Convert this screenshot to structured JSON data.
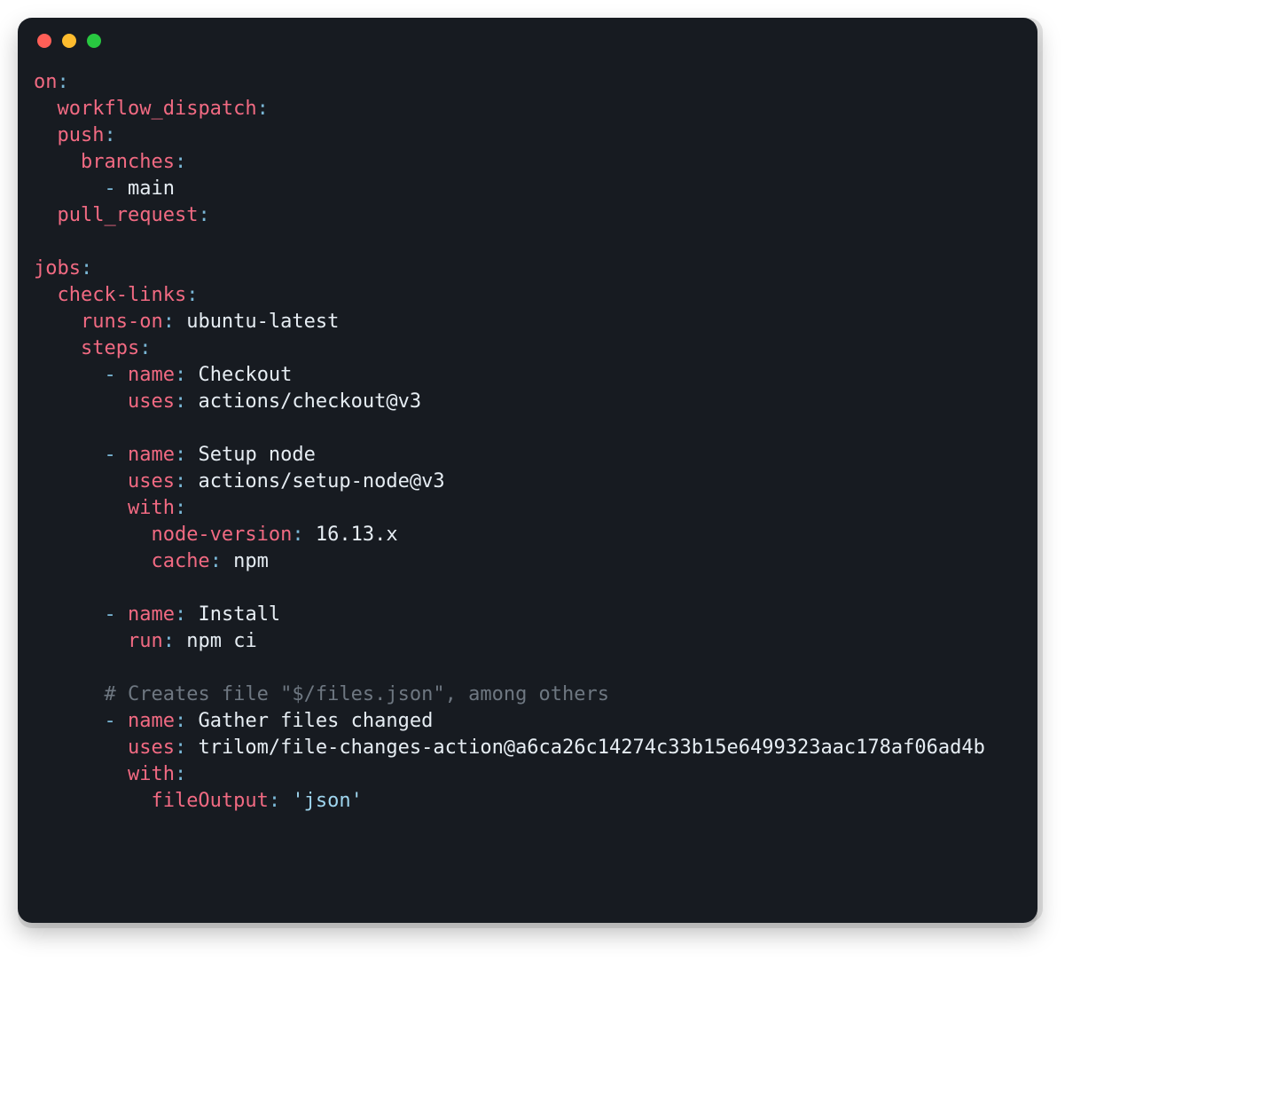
{
  "lines": [
    [
      {
        "t": "on",
        "c": "key"
      },
      {
        "t": ":",
        "c": "punct"
      }
    ],
    [
      {
        "t": "  ",
        "c": "plain"
      },
      {
        "t": "workflow_dispatch",
        "c": "key"
      },
      {
        "t": ":",
        "c": "punct"
      }
    ],
    [
      {
        "t": "  ",
        "c": "plain"
      },
      {
        "t": "push",
        "c": "key"
      },
      {
        "t": ":",
        "c": "punct"
      }
    ],
    [
      {
        "t": "    ",
        "c": "plain"
      },
      {
        "t": "branches",
        "c": "key"
      },
      {
        "t": ":",
        "c": "punct"
      }
    ],
    [
      {
        "t": "      ",
        "c": "plain"
      },
      {
        "t": "-",
        "c": "dash"
      },
      {
        "t": " main",
        "c": "plain"
      }
    ],
    [
      {
        "t": "  ",
        "c": "plain"
      },
      {
        "t": "pull_request",
        "c": "key"
      },
      {
        "t": ":",
        "c": "punct"
      }
    ],
    [],
    [
      {
        "t": "jobs",
        "c": "key"
      },
      {
        "t": ":",
        "c": "punct"
      }
    ],
    [
      {
        "t": "  ",
        "c": "plain"
      },
      {
        "t": "check-links",
        "c": "key"
      },
      {
        "t": ":",
        "c": "punct"
      }
    ],
    [
      {
        "t": "    ",
        "c": "plain"
      },
      {
        "t": "runs-on",
        "c": "key"
      },
      {
        "t": ":",
        "c": "punct"
      },
      {
        "t": " ubuntu-latest",
        "c": "plain"
      }
    ],
    [
      {
        "t": "    ",
        "c": "plain"
      },
      {
        "t": "steps",
        "c": "key"
      },
      {
        "t": ":",
        "c": "punct"
      }
    ],
    [
      {
        "t": "      ",
        "c": "plain"
      },
      {
        "t": "-",
        "c": "dash"
      },
      {
        "t": " ",
        "c": "plain"
      },
      {
        "t": "name",
        "c": "key"
      },
      {
        "t": ":",
        "c": "punct"
      },
      {
        "t": " Checkout",
        "c": "plain"
      }
    ],
    [
      {
        "t": "        ",
        "c": "plain"
      },
      {
        "t": "uses",
        "c": "key"
      },
      {
        "t": ":",
        "c": "punct"
      },
      {
        "t": " actions/checkout@v3",
        "c": "plain"
      }
    ],
    [],
    [
      {
        "t": "      ",
        "c": "plain"
      },
      {
        "t": "-",
        "c": "dash"
      },
      {
        "t": " ",
        "c": "plain"
      },
      {
        "t": "name",
        "c": "key"
      },
      {
        "t": ":",
        "c": "punct"
      },
      {
        "t": " Setup node",
        "c": "plain"
      }
    ],
    [
      {
        "t": "        ",
        "c": "plain"
      },
      {
        "t": "uses",
        "c": "key"
      },
      {
        "t": ":",
        "c": "punct"
      },
      {
        "t": " actions/setup-node@v3",
        "c": "plain"
      }
    ],
    [
      {
        "t": "        ",
        "c": "plain"
      },
      {
        "t": "with",
        "c": "key"
      },
      {
        "t": ":",
        "c": "punct"
      }
    ],
    [
      {
        "t": "          ",
        "c": "plain"
      },
      {
        "t": "node-version",
        "c": "key"
      },
      {
        "t": ":",
        "c": "punct"
      },
      {
        "t": " 16.13.x",
        "c": "plain"
      }
    ],
    [
      {
        "t": "          ",
        "c": "plain"
      },
      {
        "t": "cache",
        "c": "key"
      },
      {
        "t": ":",
        "c": "punct"
      },
      {
        "t": " npm",
        "c": "plain"
      }
    ],
    [],
    [
      {
        "t": "      ",
        "c": "plain"
      },
      {
        "t": "-",
        "c": "dash"
      },
      {
        "t": " ",
        "c": "plain"
      },
      {
        "t": "name",
        "c": "key"
      },
      {
        "t": ":",
        "c": "punct"
      },
      {
        "t": " Install",
        "c": "plain"
      }
    ],
    [
      {
        "t": "        ",
        "c": "plain"
      },
      {
        "t": "run",
        "c": "key"
      },
      {
        "t": ":",
        "c": "punct"
      },
      {
        "t": " npm ci",
        "c": "plain"
      }
    ],
    [],
    [
      {
        "t": "      ",
        "c": "plain"
      },
      {
        "t": "# Creates file \"$/files.json\", among others",
        "c": "comment"
      }
    ],
    [
      {
        "t": "      ",
        "c": "plain"
      },
      {
        "t": "-",
        "c": "dash"
      },
      {
        "t": " ",
        "c": "plain"
      },
      {
        "t": "name",
        "c": "key"
      },
      {
        "t": ":",
        "c": "punct"
      },
      {
        "t": " Gather files changed",
        "c": "plain"
      }
    ],
    [
      {
        "t": "        ",
        "c": "plain"
      },
      {
        "t": "uses",
        "c": "key"
      },
      {
        "t": ":",
        "c": "punct"
      },
      {
        "t": " trilom/file-changes-action@a6ca26c14274c33b15e6499323aac178af06ad4b",
        "c": "plain"
      }
    ],
    [
      {
        "t": "        ",
        "c": "plain"
      },
      {
        "t": "with",
        "c": "key"
      },
      {
        "t": ":",
        "c": "punct"
      }
    ],
    [
      {
        "t": "          ",
        "c": "plain"
      },
      {
        "t": "fileOutput",
        "c": "key"
      },
      {
        "t": ":",
        "c": "punct"
      },
      {
        "t": " ",
        "c": "plain"
      },
      {
        "t": "'json'",
        "c": "string"
      }
    ]
  ]
}
